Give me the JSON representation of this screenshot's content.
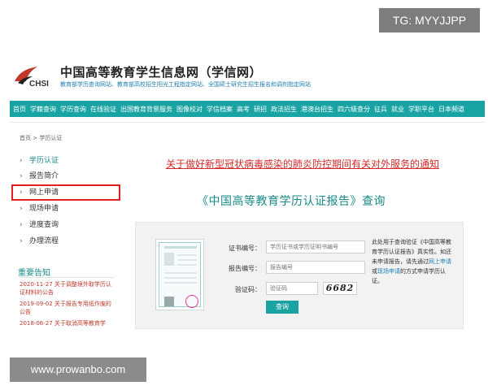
{
  "overlay": {
    "tg_badge": "TG: MYYJJPP",
    "watermark": "www.prowanbo.com"
  },
  "header": {
    "logo_text": "CHSI",
    "title": "中国高等教育学生信息网（学信网）",
    "subtitle": "教育部学历查询网站、教育部高校招生阳光工程指定网站、全国硕士研究生招生报名和调剂指定网站"
  },
  "nav": {
    "items": [
      "首页",
      "学籍查询",
      "学历查询",
      "在线验证",
      "出国教育背景服务",
      "图像校对",
      "学信档案",
      "高考",
      "研招",
      "政法招生",
      "港澳台招生",
      "四六级查分",
      "征兵",
      "就业",
      "学职平台",
      "日本频道"
    ]
  },
  "breadcrumb": "首页 > 学历认证",
  "sidebar": {
    "items": [
      {
        "label": "学历认证",
        "active": true
      },
      {
        "label": "报告简介",
        "active": false
      },
      {
        "label": "网上申请",
        "active": false
      },
      {
        "label": "现场申请",
        "active": false
      },
      {
        "label": "进度查询",
        "active": false
      },
      {
        "label": "办理流程",
        "active": false
      }
    ],
    "notice_title": "重要告知",
    "notices": [
      "2020-11-27 关于调整境外取学历认证材料的公告",
      "2019-09-02 关于报告专用纸作废的公告",
      "2018-06-27 关于取消高等教育学"
    ]
  },
  "main": {
    "alert": "关于做好新型冠状病毒感染的肺炎防控期间有关对外服务的通知",
    "report_title": "《中国高等教育学历认证报告》查询",
    "form": {
      "cert_label": "证书编号：",
      "cert_placeholder": "学历证书或学历证明书编号",
      "report_label": "报告编号：",
      "report_placeholder": "报告编号",
      "captcha_label": "验证码：",
      "captcha_placeholder": "验证码",
      "captcha_value": "6682",
      "query_button": "查询"
    },
    "help": {
      "text1": "此处用于查询验证《中国高等教育学历认证报告》真实性。如还未申请报告，请先通过",
      "link1": "网上申请",
      "text2": "或",
      "link2": "现场申请",
      "text3": "的方式申请学历认证。"
    }
  },
  "colors": {
    "accent": "#1aa3a3",
    "alert": "#d62b2b",
    "highlight_border": "#e02020",
    "link": "#1a7fb5"
  }
}
